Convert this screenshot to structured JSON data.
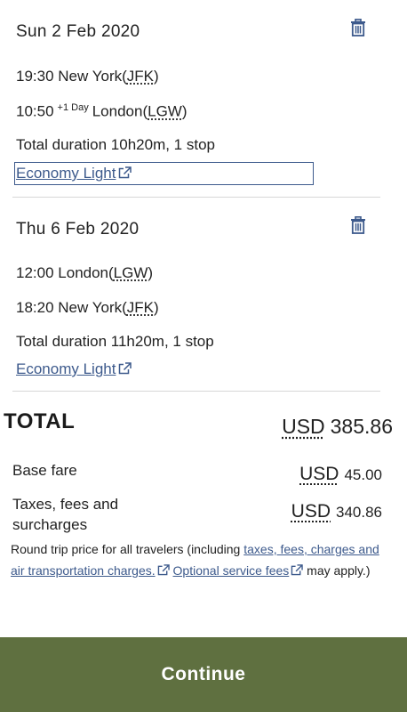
{
  "segments": [
    {
      "date": "Sun 2 Feb 2020",
      "depart_time": "19:30",
      "depart_city": "New York(",
      "depart_code": "JFK",
      "depart_close": ")",
      "arrive_time": "10:50",
      "arrive_plus": "+1 Day",
      "arrive_city": "London(",
      "arrive_code": "LGW",
      "arrive_close": ")",
      "duration": "Total duration 10h20m, 1 stop",
      "fare": "Economy Light"
    },
    {
      "date": "Thu 6 Feb 2020",
      "depart_time": "12:00",
      "depart_city": "London(",
      "depart_code": "LGW",
      "depart_close": ")",
      "arrive_time": "18:20",
      "arrive_city": "New York(",
      "arrive_code": "JFK",
      "arrive_close": ")",
      "duration": "Total duration 11h20m, 1 stop",
      "fare": "Economy Light"
    }
  ],
  "total": {
    "label": "TOTAL",
    "currency": "USD",
    "amount": "385.86"
  },
  "breakdown": {
    "base_label": "Base fare",
    "base_currency": "USD",
    "base_amount": "45.00",
    "taxes_label_1": "Taxes, fees and",
    "taxes_label_2": "surcharges",
    "taxes_currency": "USD",
    "taxes_amount": "340.86"
  },
  "note": {
    "text_1": "Round trip price for all travelers (including ",
    "link_1": "taxes, fees, charges and air transportation charges.",
    "link_2": "Optional service fees",
    "text_2": " may apply.)"
  },
  "continue_label": "Continue",
  "colors": {
    "link": "#3d5a8c",
    "button": "#5f7040",
    "divider": "#d7d7d7"
  },
  "icons": [
    "trash-icon",
    "external-link-icon"
  ]
}
